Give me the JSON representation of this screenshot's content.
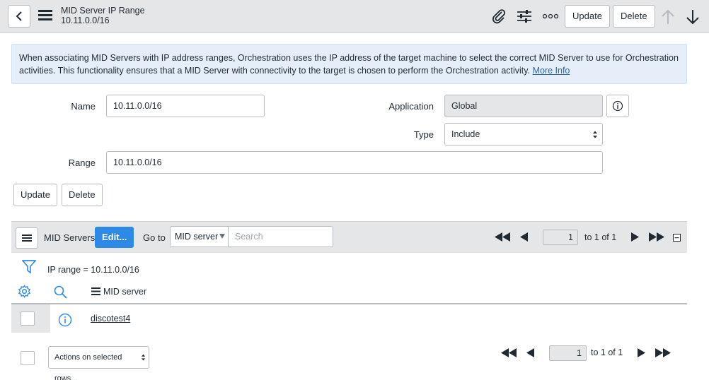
{
  "header": {
    "title": "MID Server IP Range",
    "subtitle": "10.11.0.0/16",
    "update_label": "Update",
    "delete_label": "Delete"
  },
  "info": {
    "text": "When associating MID Servers with IP address ranges, Orchestration uses the IP address of the target machine to select the correct MID Server to use for Orchestration activities. This functionality ensures that a MID Server with connectivity to the target is chosen to perform the Orchestration activity.",
    "link": "More Info"
  },
  "form": {
    "name_label": "Name",
    "name_value": "10.11.0.0/16",
    "application_label": "Application",
    "application_value": "Global",
    "type_label": "Type",
    "type_value": "Include",
    "range_label": "Range",
    "range_value": "10.11.0.0/16",
    "update_label": "Update",
    "delete_label": "Delete"
  },
  "related_list": {
    "title": "MID Servers",
    "edit_label": "Edit...",
    "goto_label": "Go to",
    "goto_field": "MID server",
    "search_placeholder": "Search",
    "page_value": "1",
    "page_total": "to 1 of 1",
    "filter_text": "IP range = 10.11.0.0/16",
    "column_header": "MID server",
    "rows": [
      {
        "mid_server": "discotest4"
      }
    ],
    "actions_label": "Actions on selected rows...",
    "bottom_page_value": "1",
    "bottom_page_total": "to 1 of 1"
  },
  "colors": {
    "accent": "#2c8ae6",
    "header_bg": "#e5e6e8",
    "info_bg": "#e6eff9",
    "link": "#2a66b0"
  }
}
